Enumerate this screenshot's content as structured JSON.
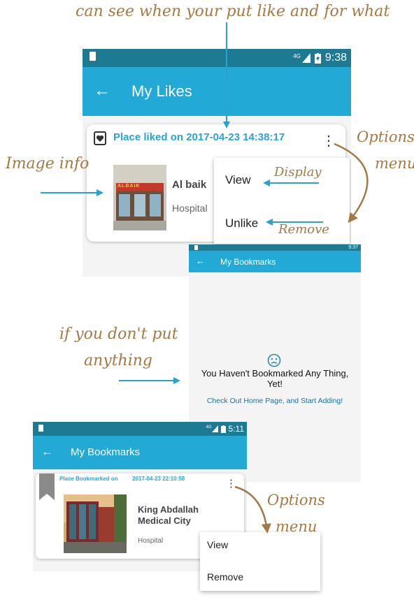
{
  "annotations": {
    "top": "can see when your put like and for what",
    "image_info": "Image info",
    "options_menu_1a": "Options",
    "options_menu_1b": "menu",
    "display": "Display",
    "remove": "Remove",
    "empty_a": "if you don't put",
    "empty_b": "anything",
    "options_menu_2a": "Options",
    "options_menu_2b": "menu",
    "arrow_color": "#2a9fd0",
    "brown_color": "#a37a45"
  },
  "likes_screen": {
    "status": {
      "network": "4G",
      "time": "9:38"
    },
    "title": "My Likes",
    "card": {
      "liked_text": "Place liked on 2017-04-23 14:38:17",
      "place_name": "Al baik",
      "category": "Hospital",
      "image_sign": "ALBAIK"
    },
    "menu": {
      "view": "View",
      "unlike": "Unlike"
    }
  },
  "empty_screen": {
    "status": {
      "time": "9:37"
    },
    "title": "My Bookmarks",
    "message": "You Haven't Bookmarked Any Thing, Yet!",
    "link": "Check Out Home Page, and Start Adding!",
    "face_icon": "sad-face-icon"
  },
  "bookmarks_screen": {
    "status": {
      "network": "4G",
      "time": "5:11"
    },
    "title": "My Bookmarks",
    "card": {
      "label": "Place Bookmarked on",
      "date": "2017-04-23 22:10:58",
      "place_name": "King Abdallah Medical City",
      "category": "Hospital"
    },
    "menu": {
      "view": "View",
      "remove": "Remove"
    }
  },
  "colors": {
    "appbar": "#22a9d6",
    "statusbar": "#1d7a93",
    "accent_text": "#2aa3d6"
  }
}
